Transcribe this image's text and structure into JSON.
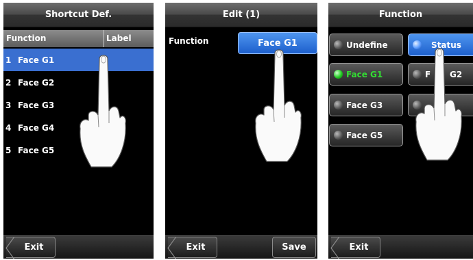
{
  "shortcut_screen": {
    "title": "Shortcut Def.",
    "columns": {
      "function": "Function",
      "label": "Label"
    },
    "rows": [
      {
        "num": "1",
        "name": "Face G1",
        "selected": true
      },
      {
        "num": "2",
        "name": "Face G2",
        "selected": false
      },
      {
        "num": "3",
        "name": "Face G3",
        "selected": false
      },
      {
        "num": "4",
        "name": "Face G4",
        "selected": false
      },
      {
        "num": "5",
        "name": "Face G5",
        "selected": false
      }
    ],
    "exit_label": "Exit"
  },
  "edit_screen": {
    "title": "Edit (1)",
    "function_label": "Function",
    "function_value": "Face G1",
    "exit_label": "Exit",
    "save_label": "Save"
  },
  "function_screen": {
    "title": "Function",
    "options": {
      "undefine": "Undefine",
      "status": "Status",
      "face_g1": "Face G1",
      "face_g2": "F",
      "face_g2_tail": "G2",
      "face_g3": "Face G3",
      "face_g5": "Face G5"
    },
    "exit_label": "Exit"
  },
  "colors": {
    "selection_blue": "#3a6fd0",
    "active_green": "#33dd33",
    "screen_black": "#000000"
  }
}
